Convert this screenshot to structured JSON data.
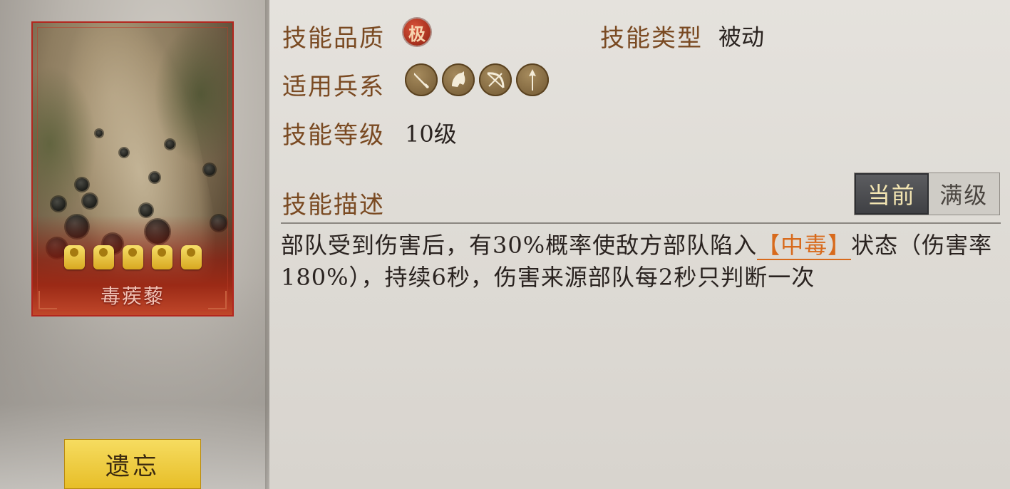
{
  "card": {
    "name": "毒蒺藜",
    "star_count": 5
  },
  "buttons": {
    "forget_label": "遗忘"
  },
  "skill": {
    "quality_label": "技能品质",
    "quality_badge": "极",
    "type_label": "技能类型",
    "type_value": "被动",
    "troops_label": "适用兵系",
    "troop_icons": [
      "shield-infantry-icon",
      "cavalry-horse-icon",
      "archer-bow-icon",
      "spear-icon"
    ],
    "level_label": "技能等级",
    "level_value": "10级",
    "desc_label": "技能描述",
    "desc_part1": "部队受到伤害后，有30%概率使敌方部队陷入",
    "desc_highlight": "【中毒】",
    "desc_part2": "状态（伤害率180%），持续6秒，伤害来源部队每2秒只判断一次"
  },
  "toggle": {
    "current_label": "当前",
    "max_label": "满级",
    "selected": "current"
  },
  "colors": {
    "label": "#7a4a22",
    "highlight": "#d86a1c",
    "button": "#e7be28",
    "card_border": "#b3261e"
  }
}
